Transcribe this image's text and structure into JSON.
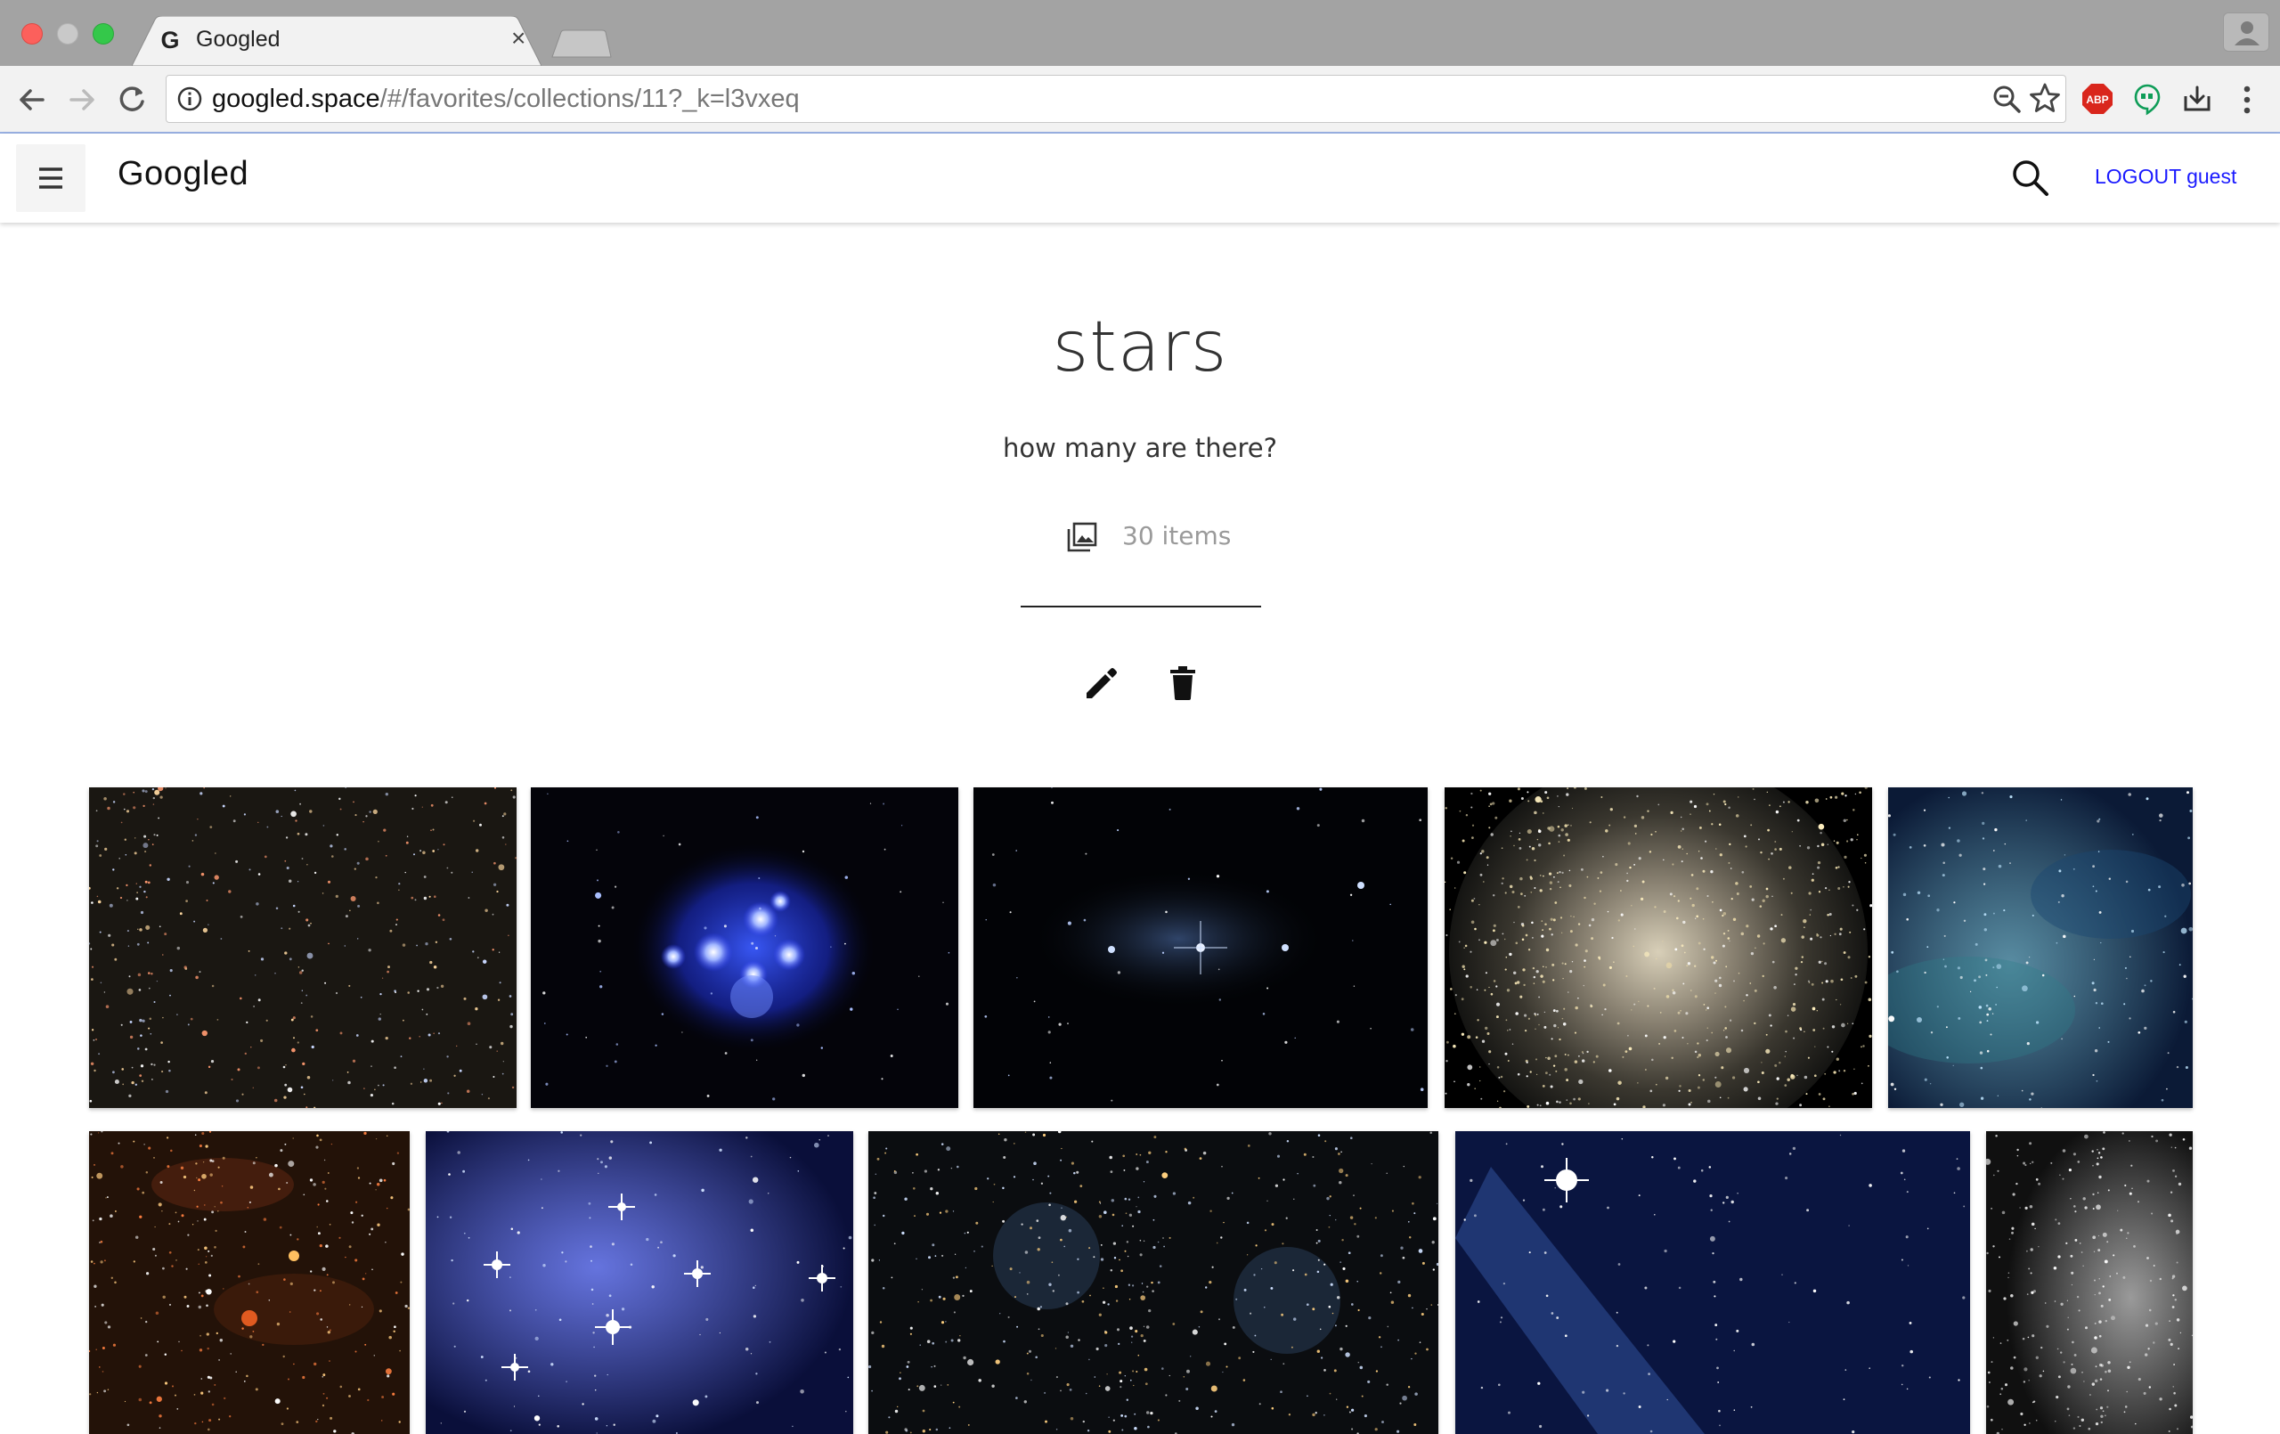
{
  "browser": {
    "tab_title": "Googled",
    "tab_close": "×",
    "url_host": "googled.space",
    "url_path": "/#/favorites/collections/11?_k=l3vxeq",
    "extensions": [
      "abp-icon",
      "hangouts-icon",
      "save-page-icon"
    ],
    "abp_label": "ABP"
  },
  "app": {
    "brand": "Googled",
    "logout_label": "LOGOUT guest"
  },
  "collection": {
    "title": "stars",
    "description": "how many are there?",
    "item_count": "30 items"
  },
  "colors": {
    "link": "#1a1aff",
    "title": "#333333",
    "muted": "#9a9a9a"
  },
  "gallery": {
    "visible_images": 10
  }
}
